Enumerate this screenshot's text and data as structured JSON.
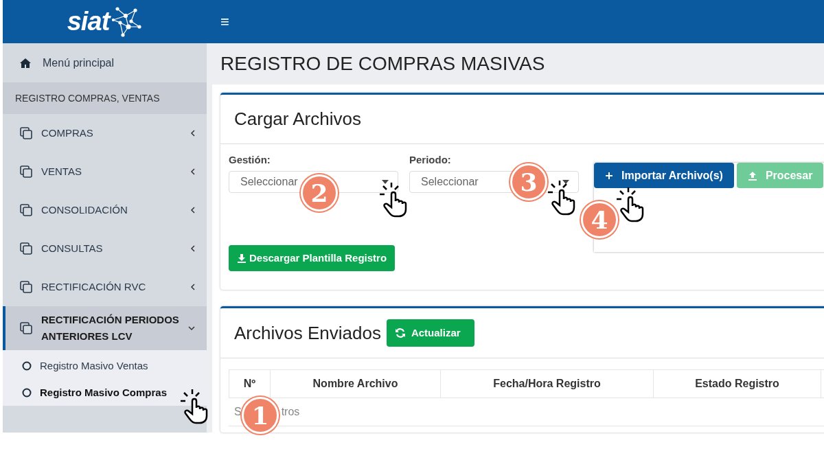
{
  "brand": "siat",
  "menu_button": "≡",
  "sidebar": {
    "home": "Menú principal",
    "section": "REGISTRO COMPRAS, VENTAS",
    "items": [
      {
        "label": "COMPRAS",
        "expanded": false
      },
      {
        "label": "VENTAS",
        "expanded": false
      },
      {
        "label": "CONSOLIDACIÓN",
        "expanded": false
      },
      {
        "label": "CONSULTAS",
        "expanded": false
      },
      {
        "label": "RECTIFICACIÓN RVC",
        "expanded": false
      },
      {
        "label": "RECTIFICACIÓN PERIODOS ANTERIORES LCV",
        "expanded": true,
        "children": [
          {
            "label": "Registro Masivo Ventas",
            "selected": false
          },
          {
            "label": "Registro Masivo Compras",
            "selected": true
          }
        ]
      }
    ]
  },
  "page_title": "REGISTRO DE COMPRAS MASIVAS",
  "upload_card": {
    "title": "Cargar Archivos",
    "fields": [
      {
        "label": "Gestión:",
        "placeholder": "Seleccionar"
      },
      {
        "label": "Periodo:",
        "placeholder": "Seleccionar"
      }
    ],
    "buttons": [
      {
        "label": "Importar Archivo(s)",
        "disabled": false
      },
      {
        "label": "Procesar",
        "disabled": true
      }
    ],
    "download_button": "Descargar Plantilla Registro"
  },
  "sent_card": {
    "title": "Archivos Enviados",
    "refresh_button": "Actualizar",
    "table": {
      "columns": [
        "Nº",
        "Nombre Archivo",
        "Fecha/Hora Registro",
        "Estado Registro"
      ],
      "empty_text_parts": [
        "S",
        "tros"
      ]
    }
  },
  "annotations": [
    "1",
    "2",
    "3",
    "4"
  ]
}
